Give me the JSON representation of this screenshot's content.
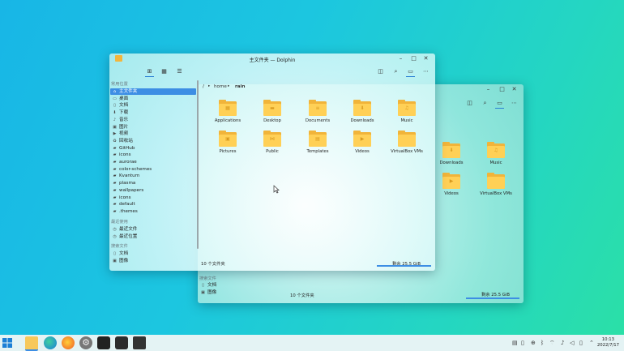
{
  "front_window": {
    "title": "主文件夹 — Dolphin",
    "breadcrumb": [
      "/",
      "home",
      "rain"
    ],
    "sidebar": {
      "headings": {
        "places": "常用位置",
        "recent": "最近使用",
        "search": "搜索文件"
      },
      "places": [
        {
          "label": "主文件夹",
          "icon": "home-icon",
          "selected": true
        },
        {
          "label": "桌面",
          "icon": "desktop-icon"
        },
        {
          "label": "文档",
          "icon": "document-icon"
        },
        {
          "label": "下载",
          "icon": "download-icon"
        },
        {
          "label": "音乐",
          "icon": "music-icon"
        },
        {
          "label": "图片",
          "icon": "picture-icon"
        },
        {
          "label": "视频",
          "icon": "video-icon"
        },
        {
          "label": "回收站",
          "icon": "trash-icon"
        },
        {
          "label": "GitHub",
          "icon": "folder-icon"
        },
        {
          "label": "icons",
          "icon": "folder-icon"
        },
        {
          "label": "aurorae",
          "icon": "folder-icon"
        },
        {
          "label": "color-schemes",
          "icon": "folder-icon"
        },
        {
          "label": "Kvantum",
          "icon": "folder-icon"
        },
        {
          "label": "plasma",
          "icon": "folder-icon"
        },
        {
          "label": "wallpapers",
          "icon": "folder-icon"
        },
        {
          "label": "icons",
          "icon": "folder-icon"
        },
        {
          "label": "default",
          "icon": "folder-icon"
        },
        {
          "label": ".themes",
          "icon": "folder-icon"
        }
      ],
      "recent": [
        {
          "label": "最近文件",
          "icon": "recent-files-icon"
        },
        {
          "label": "最近位置",
          "icon": "recent-locations-icon"
        }
      ],
      "search": [
        {
          "label": "文档",
          "icon": "document-icon"
        },
        {
          "label": "图像",
          "icon": "image-icon"
        }
      ]
    },
    "folders": [
      {
        "label": "Applications",
        "glyph": "▦"
      },
      {
        "label": "Desktop",
        "glyph": "▬"
      },
      {
        "label": "Documents",
        "glyph": "≡"
      },
      {
        "label": "Downloads",
        "glyph": "⬇"
      },
      {
        "label": "Music",
        "glyph": "♫"
      },
      {
        "label": "Pictures",
        "glyph": "▣"
      },
      {
        "label": "Public",
        "glyph": "⋈"
      },
      {
        "label": "Templates",
        "glyph": "▤"
      },
      {
        "label": "Videos",
        "glyph": "▶"
      },
      {
        "label": "VirtualBox VMs",
        "glyph": ""
      }
    ],
    "status": {
      "count": "10 个文件夹",
      "free": "剩余 25.5 GiB",
      "free_used_fraction": 0.95
    }
  },
  "back_window": {
    "folders": [
      {
        "label": "Downloads",
        "glyph": "⬇"
      },
      {
        "label": "Music",
        "glyph": "♫"
      },
      {
        "label": "Videos",
        "glyph": "▶"
      },
      {
        "label": "VirtualBox VMs",
        "glyph": ""
      }
    ],
    "sidebar_partial": {
      "heading": "搜索文件",
      "items": [
        "文档",
        "图像"
      ]
    },
    "status": {
      "count": "10 个文件夹",
      "free": "剩余 25.5 GiB"
    }
  },
  "taskbar": {
    "apps": [
      "start-menu",
      "dolphin",
      "edge",
      "firefox",
      "settings",
      "github",
      "terminal",
      "inkscape"
    ],
    "clock": {
      "time": "10:13",
      "date": "2022/7/17"
    }
  },
  "colors": {
    "accent": "#3d8ee4",
    "folder": "#ffd056",
    "folder_back": "#f1b43a"
  }
}
